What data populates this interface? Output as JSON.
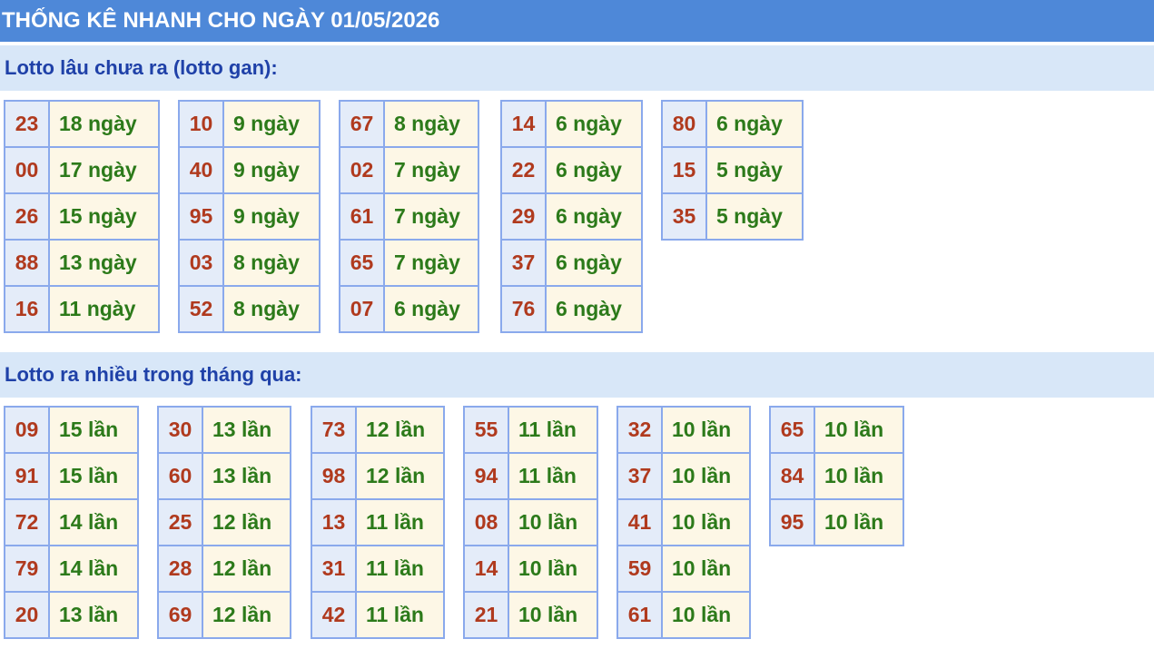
{
  "header": {
    "title": "THỐNG KÊ NHANH CHO NGÀY 01/05/2026"
  },
  "gan": {
    "title": "Lotto lâu chưa ra (lotto gan):",
    "groups": [
      [
        {
          "num": "23",
          "val": "18 ngày"
        },
        {
          "num": "00",
          "val": "17 ngày"
        },
        {
          "num": "26",
          "val": "15 ngày"
        },
        {
          "num": "88",
          "val": "13 ngày"
        },
        {
          "num": "16",
          "val": "11 ngày"
        }
      ],
      [
        {
          "num": "10",
          "val": "9 ngày"
        },
        {
          "num": "40",
          "val": "9 ngày"
        },
        {
          "num": "95",
          "val": "9 ngày"
        },
        {
          "num": "03",
          "val": "8 ngày"
        },
        {
          "num": "52",
          "val": "8 ngày"
        }
      ],
      [
        {
          "num": "67",
          "val": "8 ngày"
        },
        {
          "num": "02",
          "val": "7 ngày"
        },
        {
          "num": "61",
          "val": "7 ngày"
        },
        {
          "num": "65",
          "val": "7 ngày"
        },
        {
          "num": "07",
          "val": "6 ngày"
        }
      ],
      [
        {
          "num": "14",
          "val": "6 ngày"
        },
        {
          "num": "22",
          "val": "6 ngày"
        },
        {
          "num": "29",
          "val": "6 ngày"
        },
        {
          "num": "37",
          "val": "6 ngày"
        },
        {
          "num": "76",
          "val": "6 ngày"
        }
      ],
      [
        {
          "num": "80",
          "val": "6 ngày"
        },
        {
          "num": "15",
          "val": "5 ngày"
        },
        {
          "num": "35",
          "val": "5 ngày"
        }
      ]
    ]
  },
  "nhieu": {
    "title": "Lotto ra nhiều trong tháng qua:",
    "groups": [
      [
        {
          "num": "09",
          "val": "15 lần"
        },
        {
          "num": "91",
          "val": "15 lần"
        },
        {
          "num": "72",
          "val": "14 lần"
        },
        {
          "num": "79",
          "val": "14 lần"
        },
        {
          "num": "20",
          "val": "13 lần"
        }
      ],
      [
        {
          "num": "30",
          "val": "13 lần"
        },
        {
          "num": "60",
          "val": "13 lần"
        },
        {
          "num": "25",
          "val": "12 lần"
        },
        {
          "num": "28",
          "val": "12 lần"
        },
        {
          "num": "69",
          "val": "12 lần"
        }
      ],
      [
        {
          "num": "73",
          "val": "12 lần"
        },
        {
          "num": "98",
          "val": "12 lần"
        },
        {
          "num": "13",
          "val": "11 lần"
        },
        {
          "num": "31",
          "val": "11 lần"
        },
        {
          "num": "42",
          "val": "11 lần"
        }
      ],
      [
        {
          "num": "55",
          "val": "11 lần"
        },
        {
          "num": "94",
          "val": "11 lần"
        },
        {
          "num": "08",
          "val": "10 lần"
        },
        {
          "num": "14",
          "val": "10 lần"
        },
        {
          "num": "21",
          "val": "10 lần"
        }
      ],
      [
        {
          "num": "32",
          "val": "10 lần"
        },
        {
          "num": "37",
          "val": "10 lần"
        },
        {
          "num": "41",
          "val": "10 lần"
        },
        {
          "num": "59",
          "val": "10 lần"
        },
        {
          "num": "61",
          "val": "10 lần"
        }
      ],
      [
        {
          "num": "65",
          "val": "10 lần"
        },
        {
          "num": "84",
          "val": "10 lần"
        },
        {
          "num": "95",
          "val": "10 lần"
        }
      ]
    ]
  }
}
